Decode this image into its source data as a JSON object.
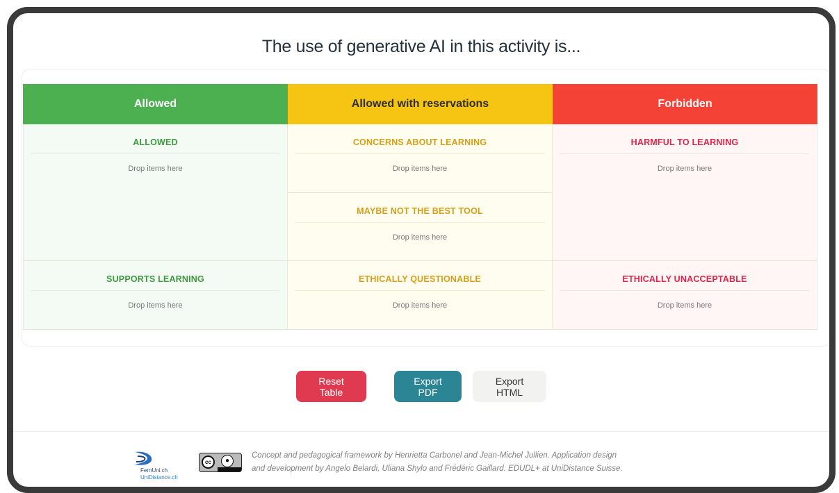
{
  "page": {
    "title": "The use of generative AI in this activity is..."
  },
  "columns": [
    {
      "header": "Allowed",
      "color": "#4caf50",
      "zones": [
        {
          "title": "ALLOWED",
          "hint": "Drop items here"
        },
        {
          "title": "SUPPORTS LEARNING",
          "hint": "Drop items here"
        }
      ]
    },
    {
      "header": "Allowed with reservations",
      "color": "#f6c514",
      "zones": [
        {
          "title": "CONCERNS ABOUT LEARNING",
          "hint": "Drop items here"
        },
        {
          "title": "MAYBE NOT THE BEST TOOL",
          "hint": "Drop items here"
        },
        {
          "title": "ETHICALLY QUESTIONABLE",
          "hint": "Drop items here"
        }
      ]
    },
    {
      "header": "Forbidden",
      "color": "#f44336",
      "zones": [
        {
          "title": "HARMFUL TO LEARNING",
          "hint": "Drop items here"
        },
        {
          "title": "ETHICALLY UNACCEPTABLE",
          "hint": "Drop items here"
        }
      ]
    }
  ],
  "buttons": {
    "reset": "Reset Table",
    "export_pdf": "Export PDF",
    "export_html": "Export HTML"
  },
  "footer": {
    "logo_line1": "FernUni.ch",
    "logo_line2": "UniDistance.ch",
    "license_icon": "cc-by-icon",
    "credits_line1": "Concept and pedagogical framework by Henrietta Carbonel and Jean-Michel Jullien. Application design",
    "credits_line2": "and development by Angelo Belardi, Uliana Shylo and Frédéric Gaillard. EDUDL+ at UniDistance Suisse."
  }
}
